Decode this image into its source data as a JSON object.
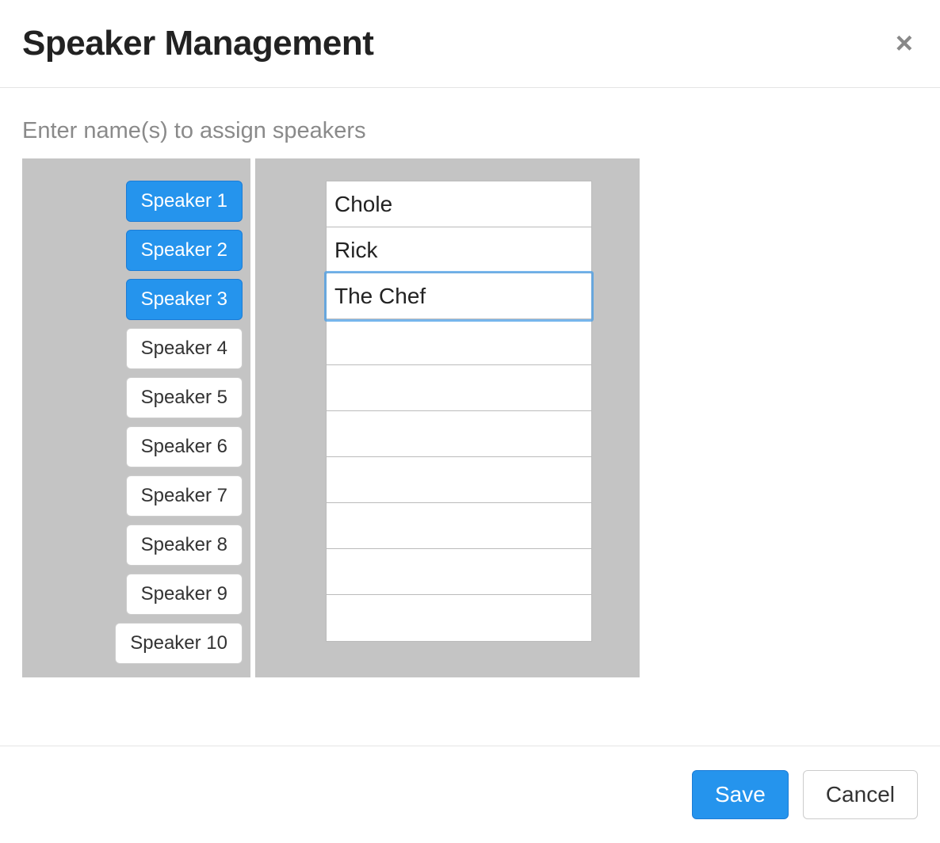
{
  "header": {
    "title": "Speaker Management",
    "close_icon": "×"
  },
  "body": {
    "instruction": "Enter name(s) to assign speakers",
    "speakers": [
      {
        "label": "Speaker 1",
        "active": true
      },
      {
        "label": "Speaker 2",
        "active": true
      },
      {
        "label": "Speaker 3",
        "active": true
      },
      {
        "label": "Speaker 4",
        "active": false
      },
      {
        "label": "Speaker 5",
        "active": false
      },
      {
        "label": "Speaker 6",
        "active": false
      },
      {
        "label": "Speaker 7",
        "active": false
      },
      {
        "label": "Speaker 8",
        "active": false
      },
      {
        "label": "Speaker 9",
        "active": false
      },
      {
        "label": "Speaker 10",
        "active": false
      }
    ],
    "names": [
      {
        "value": "Chole",
        "focused": false
      },
      {
        "value": "Rick",
        "focused": false
      },
      {
        "value": "The Chef",
        "focused": true
      },
      {
        "value": "",
        "focused": false
      },
      {
        "value": "",
        "focused": false
      },
      {
        "value": "",
        "focused": false
      },
      {
        "value": "",
        "focused": false
      },
      {
        "value": "",
        "focused": false
      },
      {
        "value": "",
        "focused": false
      },
      {
        "value": "",
        "focused": false
      }
    ]
  },
  "footer": {
    "save_label": "Save",
    "cancel_label": "Cancel"
  }
}
